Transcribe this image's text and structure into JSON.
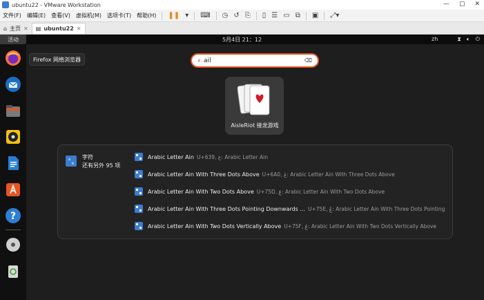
{
  "window": {
    "title": "ubuntu22 - VMware Workstation",
    "controls": [
      "—",
      "▢",
      "✕"
    ]
  },
  "menubar": {
    "items": [
      "文件(F)",
      "编辑(E)",
      "查看(V)",
      "虚拟机(M)",
      "选项卡(T)",
      "帮助(H)"
    ]
  },
  "tabs": [
    {
      "label": "主页",
      "active": false
    },
    {
      "label": "ubuntu22",
      "active": true
    }
  ],
  "topbar": {
    "activities": "活动",
    "clock": "5月4日 21：12",
    "lang": "zh"
  },
  "dock": {
    "tooltip": "Firefox 网络浏览器",
    "items": [
      "firefox-icon",
      "thunderbird-icon",
      "files-icon",
      "rhythmbox-icon",
      "libreoffice-writer-icon",
      "app-center-icon",
      "help-icon",
      "dvd-icon",
      "trash-icon"
    ]
  },
  "search": {
    "value": "ail"
  },
  "app_result": {
    "label": "AisleRiot 接龙游戏"
  },
  "provider": {
    "name": "字符",
    "more": "还有另外 95 项"
  },
  "results": [
    {
      "title": "Arabic Letter Ain",
      "desc": "U+639, ع: Arabic Letter Ain"
    },
    {
      "title": "Arabic Letter Ain With Three Dots Above",
      "desc": "U+6A0, ڠ: Arabic Letter Ain With Three Dots Above"
    },
    {
      "title": "Arabic Letter Ain With Two Dots Above",
      "desc": "U+75D, ݝ: Arabic Letter Ain With Two Dots Above"
    },
    {
      "title": "Arabic Letter Ain With Three Dots Pointing Downwards ...",
      "desc": "U+75E, ݞ: Arabic Letter Ain With Three Dots Pointing Do..."
    },
    {
      "title": "Arabic Letter Ain With Two Dots Vertically Above",
      "desc": "U+75F, ݟ: Arabic Letter Ain With Two Dots Vertically Above"
    }
  ]
}
